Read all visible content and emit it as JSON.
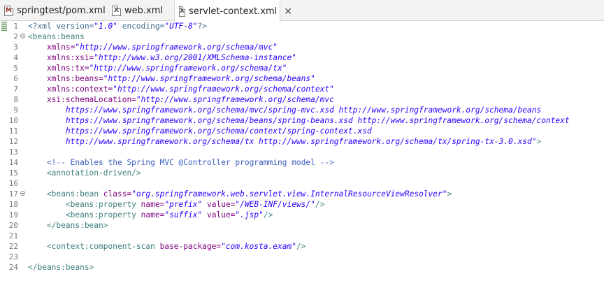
{
  "tabs": [
    {
      "label": "springtest/pom.xml",
      "icon": "maven-pom-icon",
      "active": false
    },
    {
      "label": "web.xml",
      "icon": "xml-file-icon",
      "active": false
    },
    {
      "label": "servlet-context.xml",
      "icon": "xml-file-icon",
      "active": true
    }
  ],
  "gutter": {
    "line_numbers": [
      "1",
      "2",
      "3",
      "4",
      "5",
      "6",
      "7",
      "8",
      "9",
      "10",
      "11",
      "12",
      "13",
      "14",
      "15",
      "16",
      "17",
      "18",
      "19",
      "20",
      "21",
      "22",
      "23",
      "24"
    ],
    "fold_lines": [
      "2",
      "17"
    ]
  },
  "code_lines": [
    [
      {
        "t": "<?xml version=",
        "c": "dec"
      },
      {
        "t": "\"1.0\"",
        "c": "val"
      },
      {
        "t": " encoding=",
        "c": "dec"
      },
      {
        "t": "\"UTF-8\"",
        "c": "val"
      },
      {
        "t": "?>",
        "c": "dec"
      }
    ],
    [
      {
        "t": "<beans:beans",
        "c": "tag"
      }
    ],
    [
      {
        "t": "    xmlns=",
        "c": "attr"
      },
      {
        "t": "\"http://www.springframework.org/schema/mvc\"",
        "c": "val"
      }
    ],
    [
      {
        "t": "    xmlns:xsi=",
        "c": "attr"
      },
      {
        "t": "\"http://www.w3.org/2001/XMLSchema-instance\"",
        "c": "val"
      }
    ],
    [
      {
        "t": "    xmlns:tx=",
        "c": "attr"
      },
      {
        "t": "\"http://www.springframework.org/schema/tx\"",
        "c": "val"
      }
    ],
    [
      {
        "t": "    xmlns:beans=",
        "c": "attr"
      },
      {
        "t": "\"http://www.springframework.org/schema/beans\"",
        "c": "val"
      }
    ],
    [
      {
        "t": "    xmlns:context=",
        "c": "attr"
      },
      {
        "t": "\"http://www.springframework.org/schema/context\"",
        "c": "val"
      }
    ],
    [
      {
        "t": "    xsi:schemaLocation=",
        "c": "attr"
      },
      {
        "t": "\"http://www.springframework.org/schema/mvc",
        "c": "val"
      }
    ],
    [
      {
        "t": "        https://www.springframework.org/schema/mvc/spring-mvc.xsd http://www.springframework.org/schema/beans",
        "c": "val"
      }
    ],
    [
      {
        "t": "        https://www.springframework.org/schema/beans/spring-beans.xsd http://www.springframework.org/schema/context",
        "c": "val"
      }
    ],
    [
      {
        "t": "        https://www.springframework.org/schema/context/spring-context.xsd",
        "c": "val"
      }
    ],
    [
      {
        "t": "        http://www.springframework.org/schema/tx http://www.springframework.org/schema/tx/spring-tx-3.0.xsd\"",
        "c": "val"
      },
      {
        "t": ">",
        "c": "tag"
      }
    ],
    [],
    [
      {
        "t": "    <!-- Enables the Spring MVC @Controller programming model -->",
        "c": "com"
      }
    ],
    [
      {
        "t": "    <annotation-driven/>",
        "c": "tag"
      }
    ],
    [],
    [
      {
        "t": "    <beans:bean ",
        "c": "tag"
      },
      {
        "t": "class=",
        "c": "attr"
      },
      {
        "t": "\"org.springframework.web.servlet.view.InternalResourceViewResolver\"",
        "c": "val"
      },
      {
        "t": ">",
        "c": "tag"
      }
    ],
    [
      {
        "t": "        <beans:property ",
        "c": "tag"
      },
      {
        "t": "name=",
        "c": "attr"
      },
      {
        "t": "\"prefix\"",
        "c": "val"
      },
      {
        "t": " value=",
        "c": "attr"
      },
      {
        "t": "\"/WEB-INF/views/\"",
        "c": "val"
      },
      {
        "t": "/>",
        "c": "tag"
      }
    ],
    [
      {
        "t": "        <beans:property ",
        "c": "tag"
      },
      {
        "t": "name=",
        "c": "attr"
      },
      {
        "t": "\"suffix\"",
        "c": "val"
      },
      {
        "t": " value=",
        "c": "attr"
      },
      {
        "t": "\".jsp\"",
        "c": "val"
      },
      {
        "t": "/>",
        "c": "tag"
      }
    ],
    [
      {
        "t": "    </beans:bean>",
        "c": "tag"
      }
    ],
    [],
    [
      {
        "t": "    <context:component-scan ",
        "c": "tag"
      },
      {
        "t": "base-package=",
        "c": "attr"
      },
      {
        "t": "\"com.kosta.exam\"",
        "c": "val"
      },
      {
        "t": "/>",
        "c": "tag"
      }
    ],
    [],
    [
      {
        "t": "</beans:beans>",
        "c": "tag"
      }
    ]
  ]
}
